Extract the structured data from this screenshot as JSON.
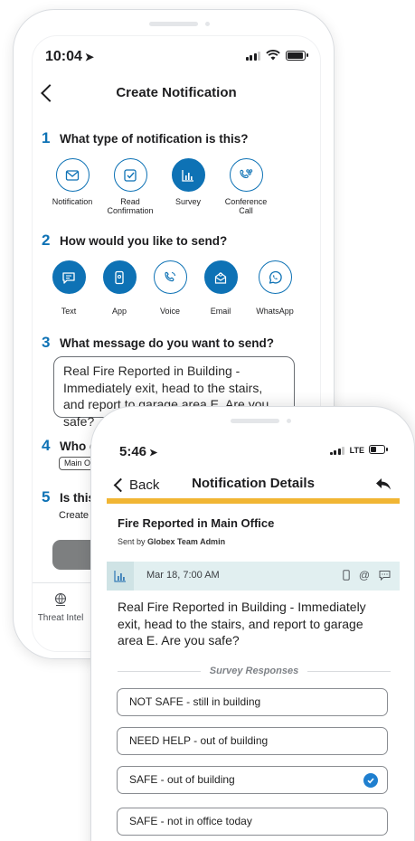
{
  "create_screen": {
    "status_time": "10:04",
    "title": "Create Notification",
    "q1": {
      "number": "1",
      "text": "What type of notification is this?"
    },
    "types": [
      {
        "label": "Notification",
        "icon": "envelope-icon",
        "selected": false
      },
      {
        "label": "Read Confirmation",
        "icon": "checkbox-icon",
        "selected": false
      },
      {
        "label": "Survey",
        "icon": "bar-chart-icon",
        "selected": true
      },
      {
        "label": "Conference Call",
        "icon": "conference-call-icon",
        "selected": false
      }
    ],
    "q2": {
      "number": "2",
      "text": "How would you like to send?"
    },
    "channels": [
      {
        "label": "Text",
        "icon": "chat-bubble-icon",
        "selected": true
      },
      {
        "label": "App",
        "icon": "phone-app-icon",
        "selected": true
      },
      {
        "label": "Voice",
        "icon": "phone-call-icon",
        "selected": false
      },
      {
        "label": "Email",
        "icon": "email-icon",
        "selected": true
      },
      {
        "label": "WhatsApp",
        "icon": "whatsapp-icon",
        "selected": false
      }
    ],
    "q3": {
      "number": "3",
      "text": "What message do you want to send?"
    },
    "message": "Real Fire Reported in Building - Immediately exit, head to the stairs, and report to garage area E. Are you safe?",
    "q4": {
      "number": "4",
      "text": "Who do"
    },
    "recipient_tag": "Main Of",
    "q5": {
      "number": "5",
      "text": "Is this a"
    },
    "create_label": "Create E",
    "send_button": "S",
    "tab_label": "Threat Intel"
  },
  "details_screen": {
    "status_time": "5:46",
    "network": "LTE",
    "back_label": "Back",
    "title": "Notification Details",
    "alert_title": "Fire Reported in Main Office",
    "sent_by_prefix": "Sent by",
    "sent_by_name": "Globex Team Admin",
    "date": "Mar 18, 7:00 AM",
    "message": "Real Fire Reported in Building - Immediately exit, head to the stairs, and report to garage area E. Are you safe?",
    "responses_heading": "Survey Responses",
    "responses": [
      {
        "label": "NOT SAFE - still in building",
        "selected": false
      },
      {
        "label": "NEED HELP - out of building",
        "selected": false
      },
      {
        "label": "SAFE - out of building",
        "selected": true
      },
      {
        "label": "SAFE - not in office today",
        "selected": false
      }
    ]
  },
  "colors": {
    "brand_blue": "#0e72b5",
    "accent_yellow": "#f1b634",
    "info_bar": "#e1eff0",
    "check_blue": "#1f7fcf"
  }
}
